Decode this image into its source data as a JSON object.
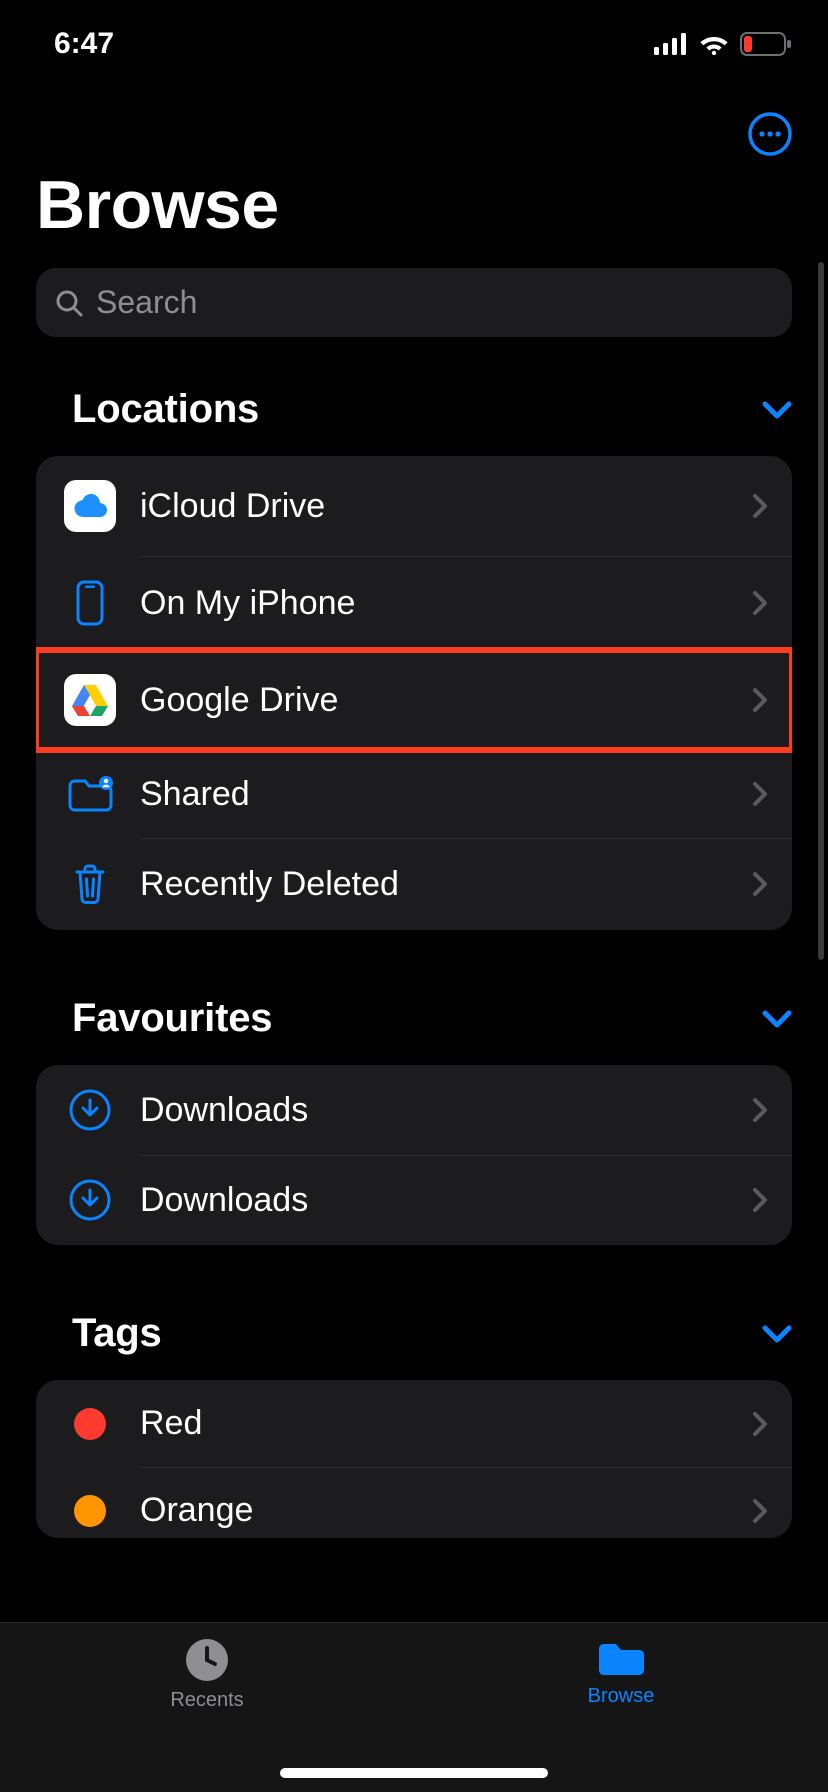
{
  "status_bar": {
    "time": "6:47"
  },
  "header": {
    "title": "Browse"
  },
  "search": {
    "placeholder": "Search"
  },
  "sections": {
    "locations": {
      "title": "Locations",
      "items": [
        {
          "id": "icloud",
          "label": "iCloud Drive"
        },
        {
          "id": "on-my-iphone",
          "label": "On My iPhone"
        },
        {
          "id": "google-drive",
          "label": "Google Drive",
          "highlighted": true
        },
        {
          "id": "shared",
          "label": "Shared"
        },
        {
          "id": "recently-deleted",
          "label": "Recently Deleted"
        }
      ]
    },
    "favourites": {
      "title": "Favourites",
      "items": [
        {
          "id": "downloads-1",
          "label": "Downloads"
        },
        {
          "id": "downloads-2",
          "label": "Downloads"
        }
      ]
    },
    "tags": {
      "title": "Tags",
      "items": [
        {
          "id": "red",
          "label": "Red",
          "color": "#ff3b30"
        },
        {
          "id": "orange",
          "label": "Orange",
          "color": "#ff9500"
        }
      ]
    }
  },
  "tab_bar": {
    "recents": "Recents",
    "browse": "Browse"
  },
  "colors": {
    "accent": "#0a84ff",
    "secondary": "#8e8e93",
    "highlight_border": "#ff3b20"
  }
}
